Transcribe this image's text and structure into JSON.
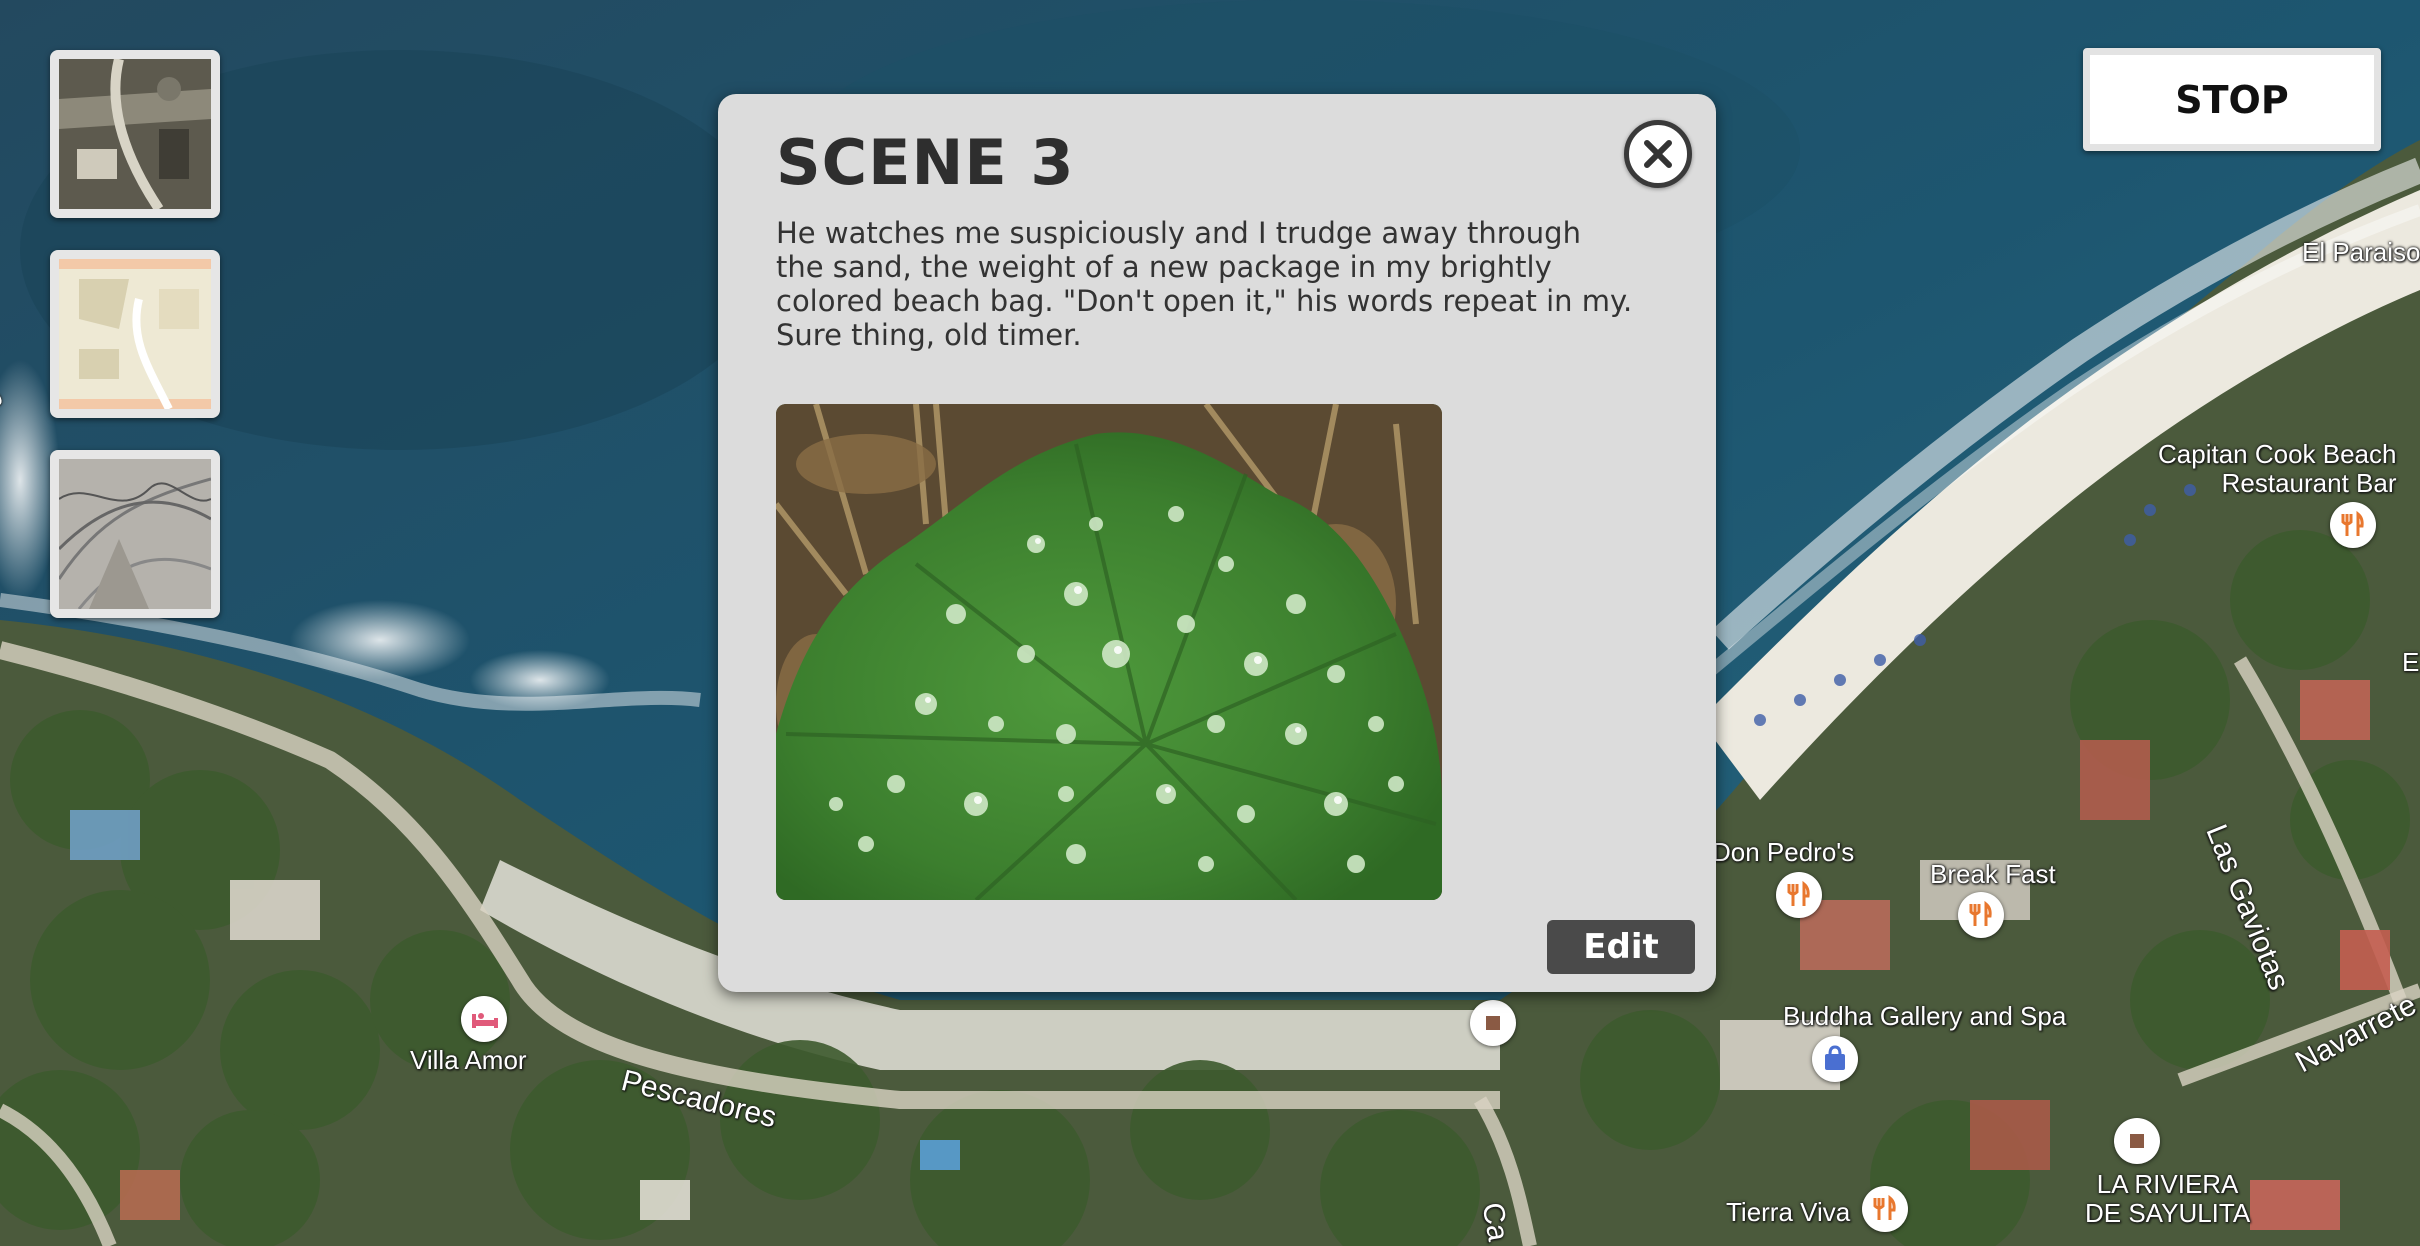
{
  "map": {
    "places": [
      {
        "id": "el-paraiso",
        "label": "El Paraiso"
      },
      {
        "id": "capitan-cook",
        "label": "Capitan Cook Beach\nRestaurant Bar"
      },
      {
        "id": "don-pedros",
        "label": "Don Pedro's"
      },
      {
        "id": "break-fast",
        "label": "Break Fast"
      },
      {
        "id": "buddha-gallery",
        "label": "Buddha Gallery and Spa"
      },
      {
        "id": "villa-amor",
        "label": "Villa Amor"
      },
      {
        "id": "tierra-viva",
        "label": "Tierra Viva"
      },
      {
        "id": "la-riviera",
        "label": "LA RIVIERA\nDE SAYULITA"
      }
    ],
    "streets": [
      {
        "id": "pescadores",
        "label": "Pescadores"
      },
      {
        "id": "las-gaviotas",
        "label": "Las Gaviotas"
      },
      {
        "id": "navarrete",
        "label": "Navarrete"
      }
    ],
    "partial_labels": {
      "left_edge": "es",
      "right_edge": "E",
      "bottom_street": "Ca"
    }
  },
  "map_types": [
    {
      "id": "satellite",
      "name": "satellite"
    },
    {
      "id": "roadmap",
      "name": "roadmap"
    },
    {
      "id": "terrain",
      "name": "terrain"
    }
  ],
  "stop_button": {
    "label": "STOP"
  },
  "scene": {
    "title": "SCENE 3",
    "text": "He watches me suspiciously and I trudge away through the sand, the weight of a new package in my brightly colored beach bag. \"Don't open it,\" his words repeat in my. Sure thing, old timer.",
    "edit_label": "Edit",
    "close_icon": "close-circle-icon"
  },
  "colors": {
    "ocean": "#1f4d63",
    "sand": "#e8e6dc",
    "dialog_bg": "#dcdcdc",
    "edit_button": "#4a4a4a",
    "poi_orange": "#e8772e",
    "poi_blue": "#4a6fd1",
    "poi_brown": "#8a5a44"
  }
}
